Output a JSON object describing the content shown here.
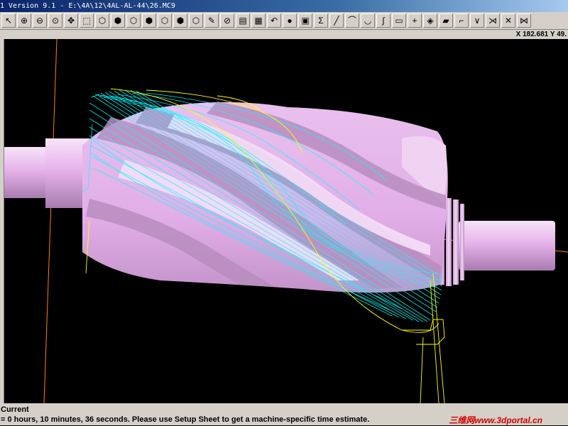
{
  "window": {
    "title": "1 Version 9.1 - E:\\4A\\12\\4AL-AL-44\\26.MC9"
  },
  "toolbar": {
    "buttons": [
      {
        "icon": "pointer-icon",
        "glyph": "↖"
      },
      {
        "icon": "zoom-in-icon",
        "glyph": "⊕"
      },
      {
        "icon": "zoom-out-icon",
        "glyph": "⊖"
      },
      {
        "icon": "zoom-window-icon",
        "glyph": "⊙"
      },
      {
        "icon": "pan-icon",
        "glyph": "✥"
      },
      {
        "icon": "select-icon",
        "glyph": "⬚"
      },
      {
        "icon": "view-top-icon",
        "glyph": "⬡"
      },
      {
        "icon": "view-front-icon",
        "glyph": "⬢"
      },
      {
        "icon": "view-side-icon",
        "glyph": "⬡"
      },
      {
        "icon": "view-iso-icon",
        "glyph": "⬢"
      },
      {
        "icon": "cube-icon",
        "glyph": "⬡"
      },
      {
        "icon": "cube-wire-icon",
        "glyph": "⬢"
      },
      {
        "icon": "cube-shaded-icon",
        "glyph": "⬡"
      },
      {
        "icon": "pencil-icon",
        "glyph": "✎"
      },
      {
        "icon": "no-entry-icon",
        "glyph": "⊘"
      },
      {
        "icon": "layers-icon",
        "glyph": "▤"
      },
      {
        "icon": "levels-icon",
        "glyph": "▦"
      },
      {
        "icon": "undo-icon",
        "glyph": "↶"
      },
      {
        "icon": "sphere-icon",
        "glyph": "●"
      },
      {
        "icon": "group-icon",
        "glyph": "▣"
      },
      {
        "icon": "sigma-icon",
        "glyph": "Σ"
      },
      {
        "icon": "line-icon",
        "glyph": "╱"
      },
      {
        "icon": "arc-icon",
        "glyph": "⌒"
      },
      {
        "icon": "curve-icon",
        "glyph": "◡"
      },
      {
        "icon": "spline-icon",
        "glyph": "∫"
      },
      {
        "icon": "rectangle-icon",
        "glyph": "▭"
      },
      {
        "icon": "point-icon",
        "glyph": "+"
      },
      {
        "icon": "solid-icon",
        "glyph": "◈"
      },
      {
        "icon": "box-icon",
        "glyph": "▰"
      },
      {
        "icon": "trim-icon",
        "glyph": "⌐"
      },
      {
        "icon": "extend-icon",
        "glyph": "∨"
      },
      {
        "icon": "break-icon",
        "glyph": "⋊"
      },
      {
        "icon": "delete-icon",
        "glyph": "✕"
      },
      {
        "icon": "mirror-icon",
        "glyph": "⋈"
      }
    ]
  },
  "coords": {
    "text": "X 182.681  Y 49."
  },
  "status": {
    "line1": "Current",
    "line2": "= 0 hours, 10 minutes, 36 seconds. Please use Setup Sheet to get a machine-specific time estimate.",
    "watermark": "三维网www.3dportal.cn"
  },
  "colors": {
    "viewport_bg": "#000000",
    "part": "#e8b8ec",
    "toolpath": "#00ffff",
    "toolpath_secondary": "#ffff00",
    "axis": "#ff8000",
    "chrome": "#d4d0c8"
  }
}
